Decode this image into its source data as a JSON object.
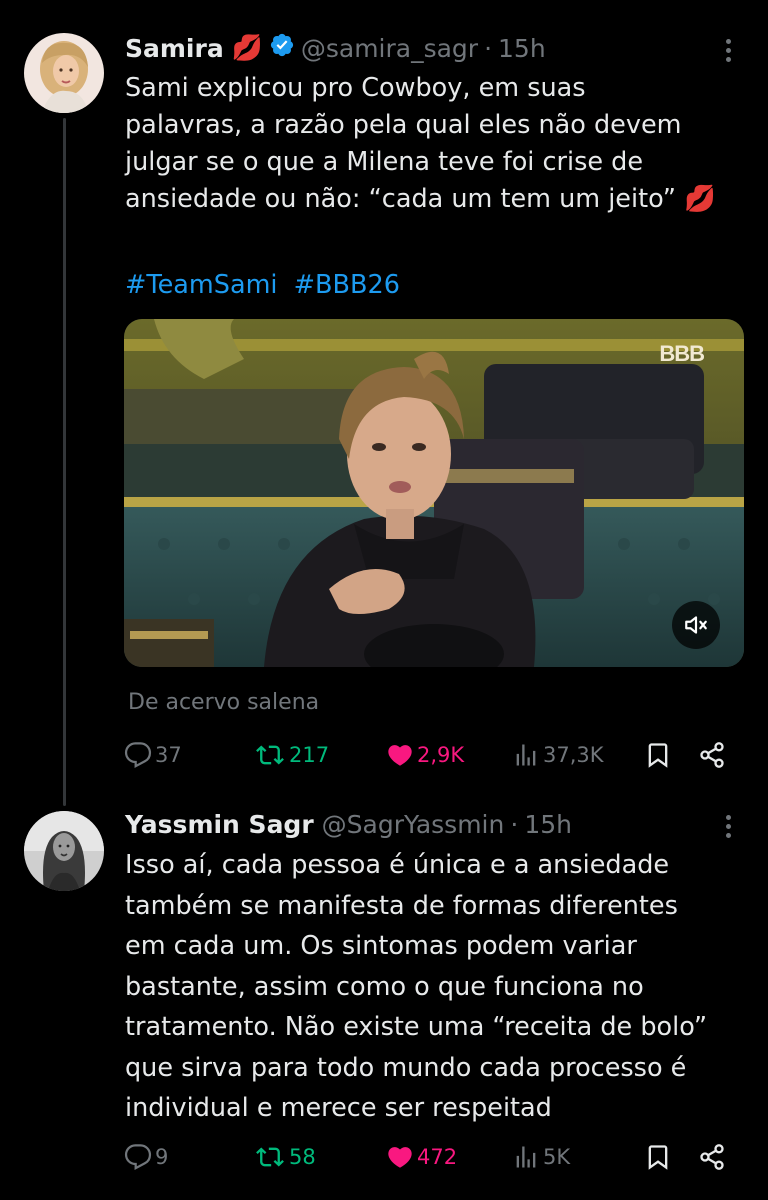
{
  "tweets": [
    {
      "author_name": "Samira",
      "author_emoji": "💋",
      "verified": true,
      "handle": "@samira_sagr",
      "separator": "·",
      "time": "15h",
      "text": "Sami explicou pro Cowboy, em suas\npalavras, a razão pela qual eles não devem\njulgar se o que a Milena teve foi crise de\nansiedade ou não: “cada um tem um jeito” 💋",
      "hashtags": [
        "#TeamSami",
        "#BBB26"
      ],
      "media": {
        "watermark": "BBB",
        "mute_icon": "volume-muted-icon"
      },
      "source": "De acervo salena",
      "stats": {
        "replies": "37",
        "retweets": "217",
        "likes": "2,9K",
        "views": "37,3K"
      }
    },
    {
      "author_name": "Yassmin Sagr",
      "verified": false,
      "handle": "@SagrYassmin",
      "separator": "·",
      "time": "15h",
      "text": "Isso aí, cada pessoa é única e a ansiedade\ntambém se manifesta de formas diferentes\nem cada um. Os sintomas podem variar\nbastante, assim como o que funciona no\ntratamento. Não existe uma “receita de bolo”\nque sirva para todo mundo cada processo é\nindividual e merece ser respeitad",
      "stats": {
        "replies": "9",
        "retweets": "58",
        "likes": "472",
        "views": "5K"
      }
    }
  ],
  "colors": {
    "background": "#000000",
    "text": "#e7e9ea",
    "muted": "#71767b",
    "link": "#1d9bf0",
    "retweet": "#00ba7c",
    "like": "#f91880",
    "verified": "#1d9bf0"
  }
}
